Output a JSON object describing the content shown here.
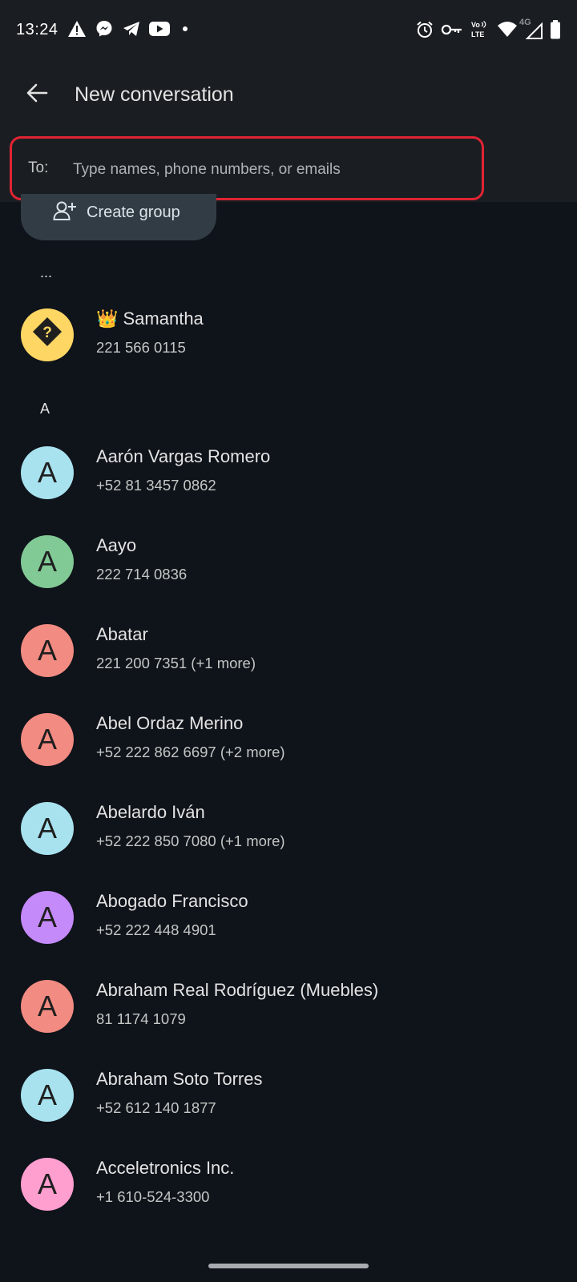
{
  "status_bar": {
    "time": "13:24",
    "network_label": "4G",
    "left_icons": [
      "warning-icon",
      "messenger-icon",
      "telegram-icon",
      "youtube-icon",
      "dot-icon"
    ],
    "right_icons": [
      "alarm-icon",
      "vpn-key-icon",
      "volte-icon",
      "wifi-icon",
      "cellular-icon",
      "battery-icon"
    ]
  },
  "app_bar": {
    "back_icon": "arrow-back-icon",
    "title": "New conversation"
  },
  "recipient": {
    "label": "To:",
    "placeholder": "Type names, phone numbers, or emails",
    "value": ""
  },
  "create_group": {
    "icon": "group-add-icon",
    "label": "Create group"
  },
  "sections": [
    {
      "header": "..."
    },
    {
      "header": "A"
    }
  ],
  "contacts": [
    {
      "name": "👑 Samantha",
      "phone": "221 566 0115",
      "avatar_letter": "?",
      "avatar_color": "#fdd663",
      "avatar_icon": "unknown-contact-icon"
    },
    {
      "name": "Aarón Vargas Romero",
      "phone": "+52 81 3457 0862",
      "avatar_letter": "A",
      "avatar_color": "#a8e2ef"
    },
    {
      "name": "Aayo",
      "phone": "222 714 0836",
      "avatar_letter": "A",
      "avatar_color": "#81c995"
    },
    {
      "name": "Abatar",
      "phone": "221 200 7351 (+1 more)",
      "avatar_letter": "A",
      "avatar_color": "#f28b82"
    },
    {
      "name": "Abel Ordaz Merino",
      "phone": "+52 222 862 6697 (+2 more)",
      "avatar_letter": "A",
      "avatar_color": "#f28b82"
    },
    {
      "name": "Abelardo Iván",
      "phone": "+52 222 850 7080 (+1 more)",
      "avatar_letter": "A",
      "avatar_color": "#a8e2ef"
    },
    {
      "name": "Abogado Francisco",
      "phone": "+52 222 448 4901",
      "avatar_letter": "A",
      "avatar_color": "#c58af9"
    },
    {
      "name": "Abraham Real Rodríguez (Muebles)",
      "phone": "81 1174 1079",
      "avatar_letter": "A",
      "avatar_color": "#f28b82"
    },
    {
      "name": "Abraham Soto Torres",
      "phone": "+52 612 140 1877",
      "avatar_letter": "A",
      "avatar_color": "#a8e2ef"
    },
    {
      "name": "Acceletronics Inc.",
      "phone": "+1 610-524-3300",
      "avatar_letter": "A",
      "avatar_color": "#ff9fd0"
    }
  ]
}
